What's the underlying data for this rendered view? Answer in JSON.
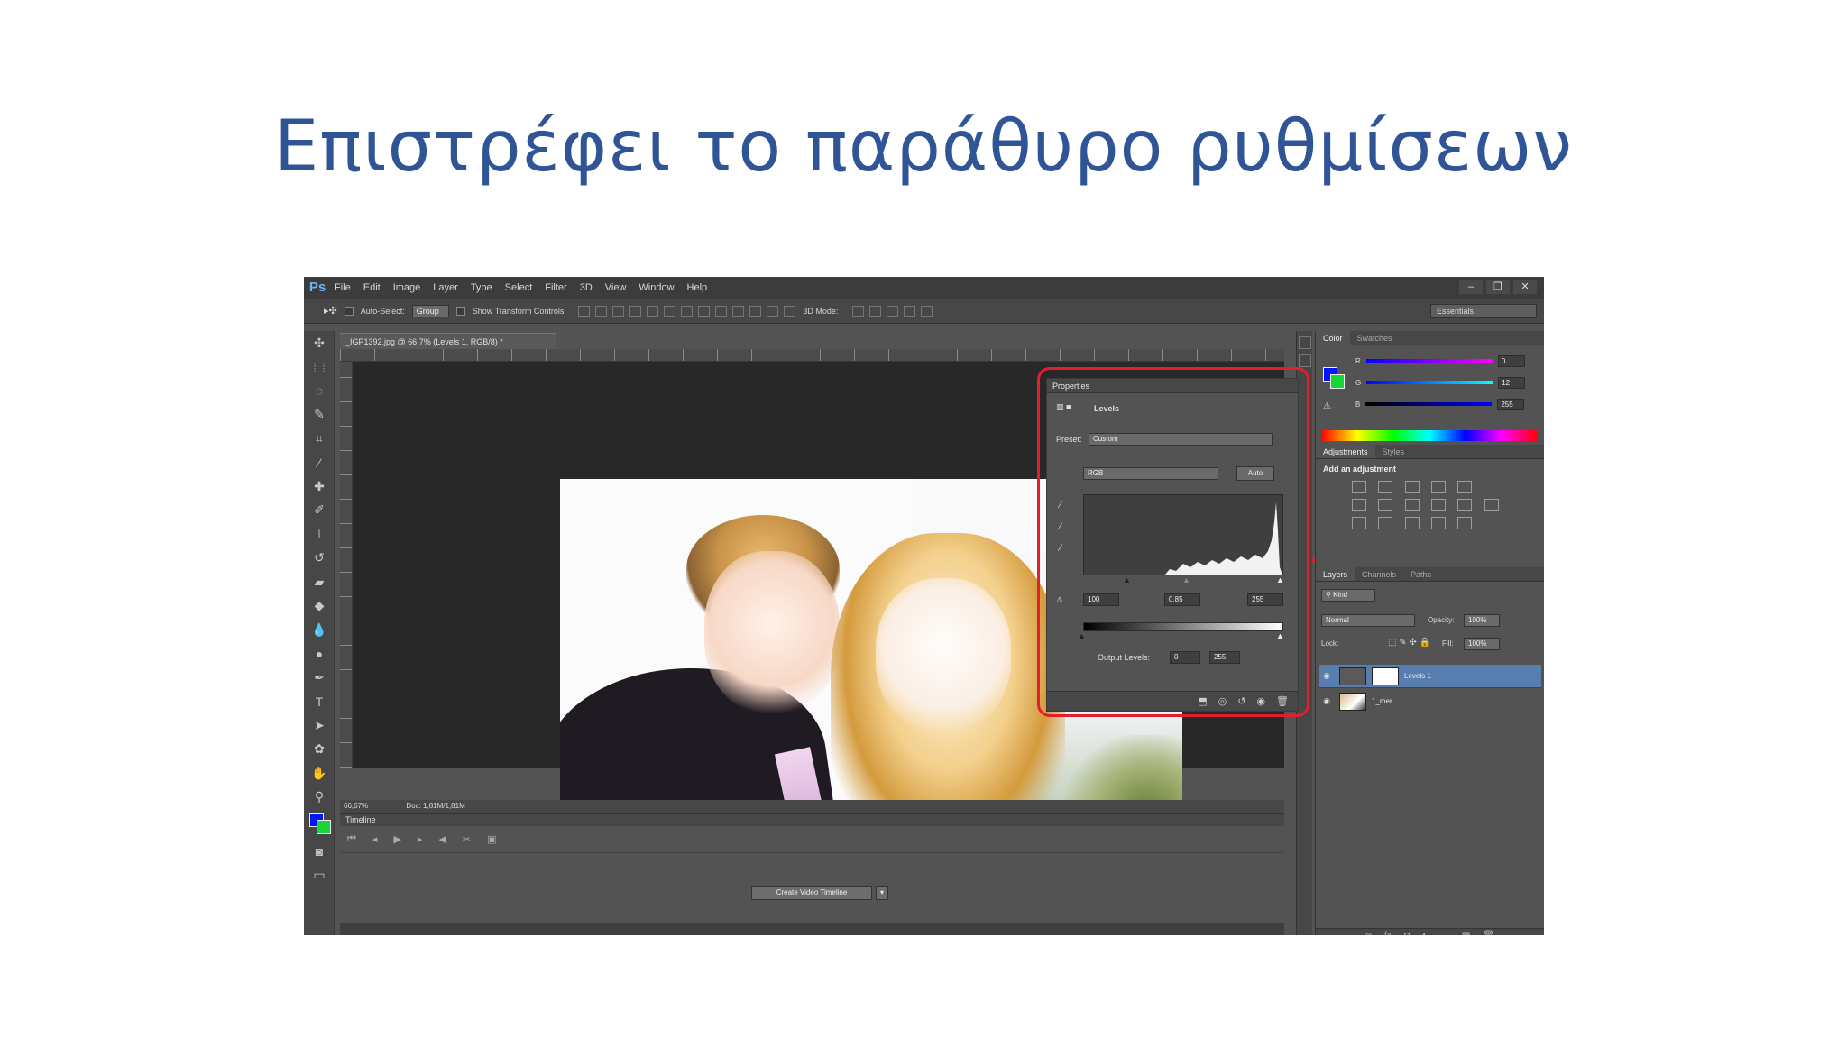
{
  "slide": {
    "title": "Επιστρέφει το παράθυρο ρυθμίσεων"
  },
  "app": {
    "logo": "Ps",
    "menu": [
      "File",
      "Edit",
      "Image",
      "Layer",
      "Type",
      "Select",
      "Filter",
      "3D",
      "View",
      "Window",
      "Help"
    ],
    "window_controls": [
      "–",
      "❐",
      "✕"
    ]
  },
  "options": {
    "auto_select_label": "Auto-Select:",
    "auto_select_value": "Group",
    "transform_label": "Show Transform Controls",
    "mode_3d_label": "3D Mode:",
    "workspace": "Essentials"
  },
  "document": {
    "tab_title": "_IGP1392.jpg @ 66,7% (Levels 1, RGB/8) *",
    "zoom": "66,67%",
    "doc_size": "Doc: 1,81M/1,81M"
  },
  "timeline": {
    "title": "Timeline",
    "create_button": "Create Video Timeline"
  },
  "properties": {
    "title": "Properties",
    "panel_name": "Levels",
    "preset_label": "Preset:",
    "preset_value": "Custom",
    "channel": "RGB",
    "auto_button": "Auto",
    "input_black": "100",
    "input_gamma": "0,85",
    "input_white": "255",
    "output_label": "Output Levels:",
    "output_black": "0",
    "output_white": "255"
  },
  "color_panel": {
    "tabs": [
      "Color",
      "Swatches"
    ],
    "fg_color": "#0015ff",
    "bg_color": "#18d63a",
    "channels": [
      {
        "label": "R",
        "value": "0"
      },
      {
        "label": "G",
        "value": "12"
      },
      {
        "label": "B",
        "value": "255"
      }
    ]
  },
  "adjustments_panel": {
    "tabs": [
      "Adjustments",
      "Styles"
    ],
    "heading": "Add an adjustment"
  },
  "layers_panel": {
    "tabs": [
      "Layers",
      "Channels",
      "Paths"
    ],
    "kind_label": "Kind",
    "blend_mode": "Normal",
    "opacity_label": "Opacity:",
    "opacity_value": "100%",
    "lock_label": "Lock:",
    "fill_label": "Fill:",
    "fill_value": "100%",
    "layers": [
      {
        "name": "Levels 1",
        "selected": true
      },
      {
        "name": "1_mer"
      }
    ]
  },
  "annotation": {
    "highlight_color": "#e0202c"
  }
}
